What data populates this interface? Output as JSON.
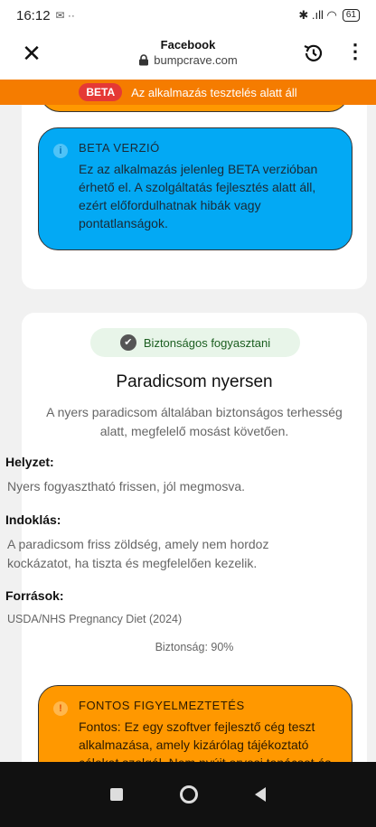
{
  "status_bar": {
    "time": "16:12",
    "notif_glyph": "✉ ··",
    "signal_glyph": "✱ .ıll ◠",
    "battery": "61"
  },
  "browser": {
    "title": "Facebook",
    "domain": "bumpcrave.com"
  },
  "beta_banner": {
    "pill": "BETA",
    "text": "Az alkalmazás tesztelés alatt áll"
  },
  "beta_info": {
    "title": "BETA VERZIÓ",
    "text": "Ez az alkalmazás jelenleg BETA verzióban érhető el. A szolgáltatás fejlesztés alatt áll, ezért előfordulhatnak hibák vagy pontatlanságok."
  },
  "result": {
    "badge": "Biztonságos fogyasztani",
    "title": "Paradicsom nyersen",
    "description": "A nyers paradicsom általában biztonságos terhesség alatt, megfelelő mosást követően.",
    "situation_label": "Helyzet:",
    "situation": "Nyers fogyasztható frissen, jól megmosva.",
    "reason_label": "Indoklás:",
    "reason": "A paradicsom friss zöldség, amely nem hordoz kockázatot, ha tiszta és megfelelően kezelik.",
    "sources_label": "Források:",
    "sources": "USDA/NHS Pregnancy Diet (2024)",
    "safety": "Biztonság: 90%"
  },
  "warning": {
    "title": "FONTOS FIGYELMEZTETÉS",
    "text": "Fontos: Ez egy szoftver fejlesztő cég teszt alkalmazása, amely kizárólag tájékoztató célokat szolgál. Nem nyújt orvosi tanácsot és nem vállal felelősséget az eredményekért. Minden egészségügyi kérdésben konzultáljon"
  },
  "colors": {
    "banner": "#f57c00",
    "info": "#03a9f4",
    "warning": "#ff9800",
    "badge_bg": "#e8f5e9"
  }
}
